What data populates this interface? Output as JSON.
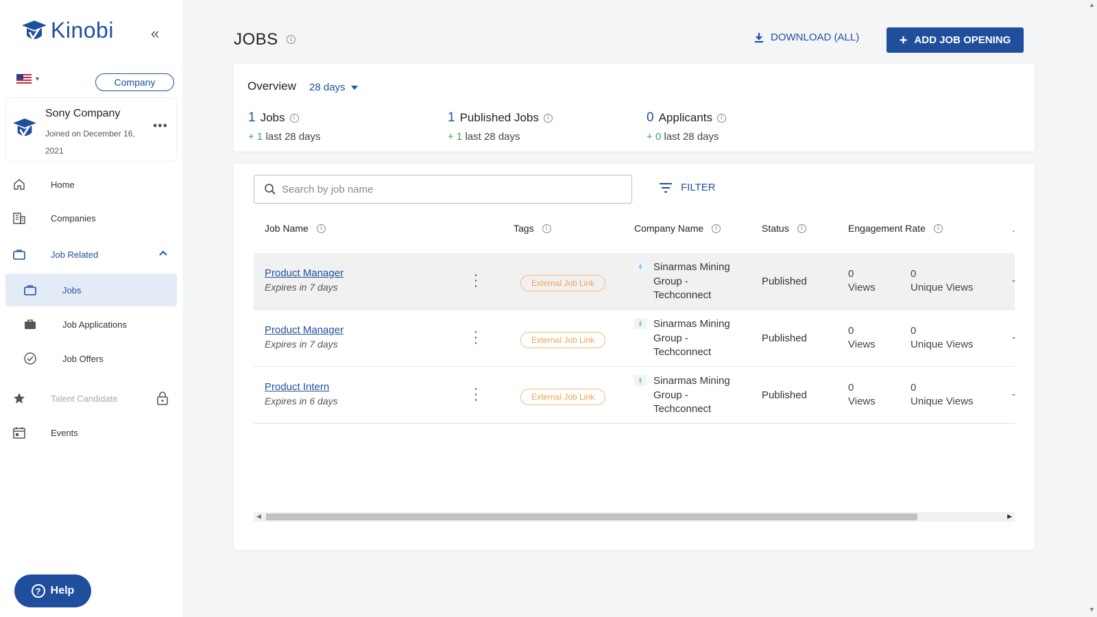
{
  "brand": {
    "name": "Kinobi",
    "color": "#1f4f9c"
  },
  "sidebar": {
    "company_button": "Company",
    "company_card": {
      "name": "Sony Company",
      "joined": "Joined on December 16, 2021"
    },
    "nav": {
      "home": "Home",
      "companies": "Companies",
      "job_related": "Job Related",
      "jobs": "Jobs",
      "job_applications": "Job Applications",
      "job_offers": "Job Offers",
      "talent_candidate": "Talent Candidate",
      "events": "Events"
    },
    "help": "Help"
  },
  "header": {
    "title": "JOBS",
    "download": "DOWNLOAD (ALL)",
    "add": "ADD JOB OPENING"
  },
  "overview": {
    "label": "Overview",
    "period": "28 days",
    "stats": [
      {
        "count": "1",
        "label": "Jobs",
        "delta_plus": "+ 1",
        "delta_text": "last 28 days"
      },
      {
        "count": "1",
        "label": "Published Jobs",
        "delta_plus": "+ 1",
        "delta_text": "last 28 days"
      },
      {
        "count": "0",
        "label": "Applicants",
        "delta_plus": "+ 0",
        "delta_text": "last 28 days"
      }
    ]
  },
  "search": {
    "placeholder": "Search by job name"
  },
  "filter": "FILTER",
  "table": {
    "columns": [
      "Job Name",
      "Tags",
      "Company Name",
      "Status",
      "Engagement Rate"
    ],
    "rows": [
      {
        "job": "Product Manager",
        "expires": "Expires in 7 days",
        "tag": "External Job Link",
        "company": "Sinarmas Mining Group - Techconnect",
        "status": "Published",
        "views": "0",
        "views_label": "Views",
        "unique": "0",
        "unique_label": "Unique Views",
        "extra": "-"
      },
      {
        "job": "Product Manager",
        "expires": "Expires in 7 days",
        "tag": "External Job Link",
        "company": "Sinarmas Mining Group - Techconnect",
        "status": "Published",
        "views": "0",
        "views_label": "Views",
        "unique": "0",
        "unique_label": "Unique Views",
        "extra": "-"
      },
      {
        "job": "Product Intern",
        "expires": "Expires in 6 days",
        "tag": "External Job Link",
        "company": "Sinarmas Mining Group - Techconnect",
        "status": "Published",
        "views": "0",
        "views_label": "Views",
        "unique": "0",
        "unique_label": "Unique Views",
        "extra": "-"
      }
    ],
    "header_extra": "."
  }
}
